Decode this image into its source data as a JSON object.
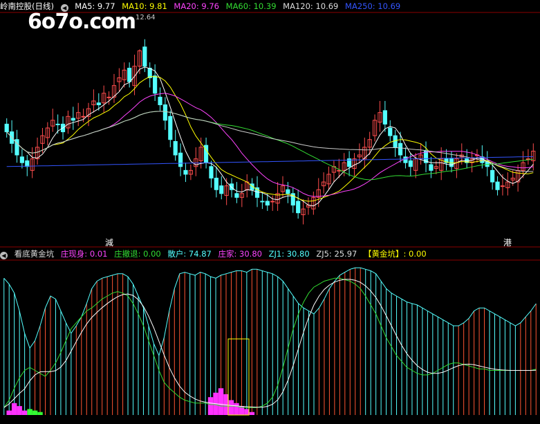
{
  "top_header": {
    "stock": "岭南控股(日线)",
    "ma5": "MA5: 9.77",
    "ma10": "MA10: 9.81",
    "ma20": "MA20: 9.76",
    "ma60": "MA60: 10.39",
    "ma120": "MA120: 10.69",
    "ma250": "MA250: 10.69"
  },
  "bottom_header": {
    "indicator": "看底黄金坑",
    "zhuang_xian": "庄现身: 0.01",
    "zhuang_che": "庄撤退: 0.00",
    "san_hu": "散户: 74.87",
    "zhuang_jia": "庄家: 30.80",
    "zj1": "ZJ1: 30.80",
    "zj5": "ZJ5: 25.97",
    "gold_pit": "【黄金坑】: 0.00"
  },
  "watermark": "6o7o.com",
  "peak_price_label": "12.64",
  "markers": {
    "left": "減",
    "right": "港"
  },
  "colors": {
    "up": "#ff4d4d",
    "down": "#54ffff",
    "ma5": "#ffffff",
    "ma10": "#ffff00",
    "ma20": "#ff44ff",
    "ma60": "#33dd33",
    "ma120": "#cccccc",
    "ma250": "#3355ff",
    "zhuang": "#ff33ff",
    "green_bar": "#33ff33",
    "gold": "#ffff00"
  },
  "chart_data": {
    "type": "candlestick",
    "ylim": [
      8.0,
      13.2
    ],
    "closes": [
      10.5,
      10.2,
      9.9,
      9.7,
      9.6,
      9.8,
      10.1,
      10.4,
      10.6,
      10.8,
      10.7,
      10.5,
      10.9,
      10.8,
      11.0,
      10.9,
      11.1,
      11.3,
      11.2,
      11.5,
      11.4,
      11.7,
      11.9,
      12.1,
      11.8,
      12.2,
      12.6,
      12.2,
      11.9,
      11.5,
      11.2,
      10.8,
      10.3,
      9.9,
      9.6,
      9.4,
      9.5,
      9.8,
      10.1,
      9.7,
      9.3,
      9.0,
      8.9,
      9.1,
      9.0,
      8.8,
      8.9,
      9.2,
      9.0,
      8.8,
      8.7,
      8.6,
      8.7,
      8.9,
      9.1,
      8.9,
      8.6,
      8.4,
      8.5,
      8.6,
      8.8,
      9.0,
      9.2,
      9.4,
      9.6,
      9.5,
      9.7,
      9.6,
      9.8,
      9.9,
      10.1,
      10.3,
      10.8,
      11.0,
      10.7,
      10.4,
      10.1,
      9.9,
      9.7,
      9.6,
      9.8,
      9.9,
      9.7,
      9.5,
      9.6,
      9.8,
      9.7,
      9.6,
      9.8,
      9.9,
      9.7,
      9.8,
      9.9,
      9.7,
      9.6,
      9.2,
      9.0,
      9.1,
      9.2,
      9.3,
      9.5,
      9.7,
      9.8,
      10.0
    ],
    "oscillator": {
      "san_hu": [
        92,
        88,
        82,
        70,
        55,
        45,
        50,
        60,
        72,
        80,
        78,
        70,
        62,
        55,
        60,
        66,
        75,
        85,
        90,
        92,
        93,
        94,
        95,
        95,
        93,
        88,
        80,
        72,
        60,
        48,
        40,
        52,
        70,
        85,
        95,
        96,
        95,
        94,
        96,
        95,
        93,
        92,
        94,
        95,
        96,
        97,
        97,
        96,
        98,
        98,
        97,
        96,
        95,
        93,
        90,
        85,
        80,
        75,
        72,
        70,
        68,
        72,
        78,
        85,
        90,
        94,
        96,
        98,
        99,
        99,
        98,
        97,
        95,
        90,
        85,
        82,
        80,
        78,
        76,
        75,
        74,
        72,
        70,
        68,
        66,
        64,
        62,
        60,
        60,
        62,
        65,
        70,
        72,
        72,
        70,
        68,
        66,
        64,
        62,
        60,
        62,
        66,
        70,
        74.87
      ],
      "zhuang_jia": [
        5,
        10,
        18,
        25,
        30,
        32,
        30,
        28,
        26,
        30,
        35,
        42,
        50,
        58,
        62,
        66,
        70,
        72,
        75,
        78,
        80,
        82,
        83,
        82,
        80,
        75,
        68,
        60,
        50,
        40,
        30,
        22,
        18,
        15,
        12,
        10,
        9,
        8,
        8,
        8,
        7,
        7,
        6,
        6,
        6,
        6,
        5,
        5,
        5,
        5,
        6,
        8,
        12,
        20,
        32,
        45,
        58,
        68,
        76,
        82,
        86,
        88,
        90,
        91,
        92,
        92,
        91,
        90,
        88,
        85,
        80,
        74,
        68,
        60,
        52,
        46,
        40,
        36,
        32,
        30,
        28,
        27,
        27,
        28,
        30,
        32,
        34,
        35,
        35,
        34,
        33,
        32,
        31,
        31,
        30,
        30,
        30,
        30,
        30,
        30,
        30,
        30,
        30,
        30.8
      ],
      "zhuang_bars": [
        0,
        3,
        8,
        6,
        3,
        1,
        0,
        0,
        0,
        0,
        0,
        0,
        0,
        0,
        0,
        0,
        0,
        0,
        0,
        0,
        0,
        0,
        0,
        0,
        0,
        0,
        0,
        0,
        0,
        0,
        0,
        0,
        0,
        0,
        0,
        0,
        0,
        0,
        0,
        0,
        12,
        15,
        18,
        14,
        10,
        8,
        6,
        4,
        2,
        0,
        0,
        0,
        0,
        0,
        0,
        0,
        0,
        0,
        0,
        0,
        0,
        0,
        0,
        0,
        0,
        0,
        0,
        0,
        0,
        0,
        0,
        0,
        0,
        0,
        0,
        0,
        0,
        0,
        0,
        0,
        0,
        0,
        0,
        0,
        0,
        0,
        0,
        0,
        0,
        0,
        0,
        0,
        0,
        0,
        0,
        0,
        0,
        0,
        0,
        0,
        0,
        0,
        0,
        0
      ],
      "green_bars": [
        0,
        0,
        0,
        0,
        0,
        4,
        3,
        2,
        0,
        0,
        0,
        0,
        0,
        0,
        0,
        0,
        0,
        0,
        0,
        0,
        0,
        0,
        0,
        0,
        0,
        0,
        0,
        0,
        0,
        0,
        0,
        0,
        0,
        0,
        0,
        0,
        0,
        0,
        0,
        0,
        0,
        0,
        0,
        0,
        0,
        0,
        0,
        0,
        0,
        0,
        0,
        0,
        0,
        0,
        0,
        0,
        0,
        0,
        0,
        0,
        0,
        0,
        0,
        0,
        0,
        0,
        0,
        0,
        0,
        0,
        0,
        0,
        0,
        0,
        0,
        0,
        0,
        0,
        0,
        0,
        0,
        0,
        0,
        0,
        0,
        0,
        0,
        0,
        0,
        0,
        0,
        0,
        0,
        0,
        0,
        0,
        0,
        0,
        0,
        0,
        0,
        0,
        0,
        0
      ],
      "ylim": [
        0,
        100
      ]
    }
  }
}
